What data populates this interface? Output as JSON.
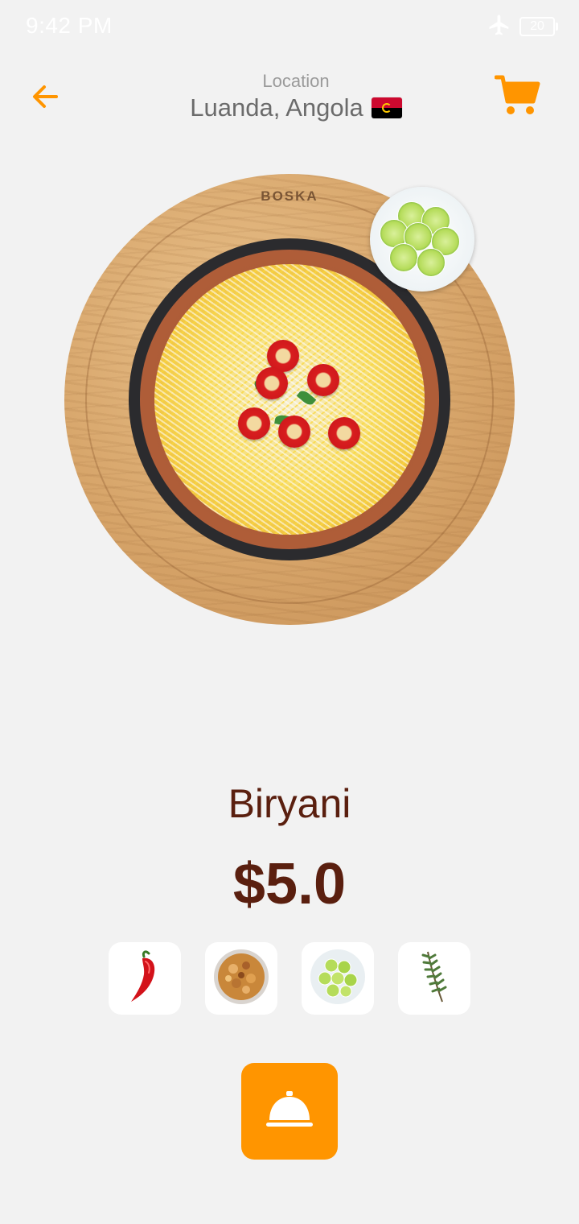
{
  "status_bar": {
    "time": "9:42 PM",
    "battery": "20",
    "airplane_icon": "airplane-icon"
  },
  "header": {
    "location_label": "Location",
    "location_value": "Luanda, Angola",
    "flag_icon": "angola-flag-icon",
    "back_icon": "arrow-left-icon",
    "cart_icon": "cart-icon"
  },
  "hero": {
    "board_brand": "BOSKA",
    "image_icon": "biryani-dish-image"
  },
  "product": {
    "name": "Biryani",
    "price": "$5.0"
  },
  "addons": [
    {
      "icon": "chili-pepper-icon"
    },
    {
      "icon": "mixed-nuts-icon"
    },
    {
      "icon": "lime-slices-icon"
    },
    {
      "icon": "rosemary-icon"
    }
  ],
  "order_button": {
    "icon": "service-bell-icon"
  },
  "colors": {
    "accent": "#ff9500",
    "title": "#5a1f0f",
    "background": "#f2f2f2"
  }
}
